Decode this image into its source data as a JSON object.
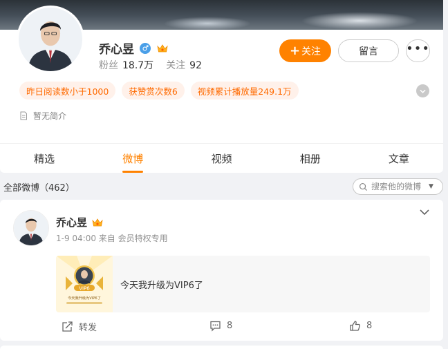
{
  "profile": {
    "name": "乔心昱",
    "stats": {
      "fans_label": "粉丝",
      "fans_value": "18.7万",
      "following_label": "关注",
      "following_value": "92"
    },
    "follow_label": "关注",
    "message_label": "留言",
    "tags": [
      "昨日阅读数小于1000",
      "获赞赏次数6",
      "视频累计播放量249.1万"
    ],
    "bio": "暂无简介"
  },
  "tabs": [
    {
      "label": "精选",
      "active": false
    },
    {
      "label": "微博",
      "active": true
    },
    {
      "label": "视频",
      "active": false
    },
    {
      "label": "相册",
      "active": false
    },
    {
      "label": "文章",
      "active": false
    }
  ],
  "feed": {
    "title": "全部微博（462）",
    "search_placeholder": "搜索他的微博"
  },
  "post": {
    "author": "乔心昱",
    "meta": "1-9 04:00  来自 会员特权专用",
    "share_text": "今天我升级为VIP6了",
    "thumb_badge": "VIP6",
    "thumb_caption": "今天我升级为VIP6了",
    "repost_label": "转发",
    "comment_count": "8",
    "like_count": "8"
  },
  "colors": {
    "accent": "#ff8200",
    "tag_bg": "#fff1ea",
    "tag_text": "#ff6a00",
    "gender_blue": "#4a9fe8"
  },
  "icons": [
    "male-gender-icon",
    "vip-crown-icon",
    "plus-icon",
    "more-dots-icon",
    "chevron-down-icon",
    "bio-doc-icon",
    "search-icon",
    "repost-icon",
    "comment-icon",
    "like-icon"
  ]
}
